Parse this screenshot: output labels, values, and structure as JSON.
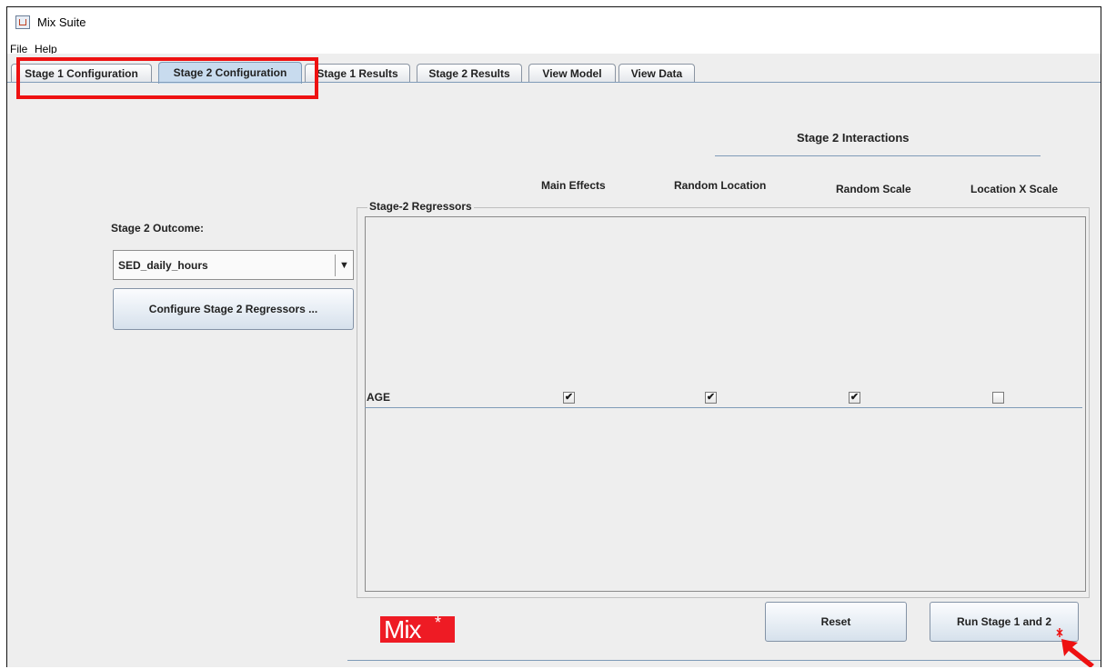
{
  "window": {
    "title": "Mix Suite",
    "icon": "java-icon"
  },
  "menu": [
    {
      "label": "File"
    },
    {
      "label": "Help"
    }
  ],
  "tabs": [
    {
      "label": "Stage 1 Configuration"
    },
    {
      "label": "Stage 2 Configuration"
    },
    {
      "label": "Stage 1 Results"
    },
    {
      "label": "Stage 2 Results"
    },
    {
      "label": "View Model"
    },
    {
      "label": "View Data"
    }
  ],
  "active_tab": "Stage 2 Configuration",
  "left": {
    "outcome_label": "Stage 2 Outcome:",
    "outcome_value": "SED_daily_hours",
    "configure_button": "Configure Stage 2 Regressors ..."
  },
  "interactions": {
    "header": "Stage 2 Interactions",
    "columns": [
      "Main Effects",
      "Random Location",
      "Random Scale",
      "Location X Scale"
    ]
  },
  "regressors": {
    "group_title": "Stage-2 Regressors",
    "rows": [
      {
        "name": "AGE",
        "main_effects": true,
        "random_location": true,
        "random_scale": true,
        "location_x_scale": false
      }
    ]
  },
  "buttons": {
    "reset": "Reset",
    "run": "Run Stage 1 and 2"
  },
  "logo": {
    "text": "Mix",
    "mark": "*"
  },
  "colors": {
    "highlight": "#ee1111",
    "logo": "#ee1b24",
    "active_tab": "#c8dbee",
    "accent_rule": "#7f9bb8"
  }
}
